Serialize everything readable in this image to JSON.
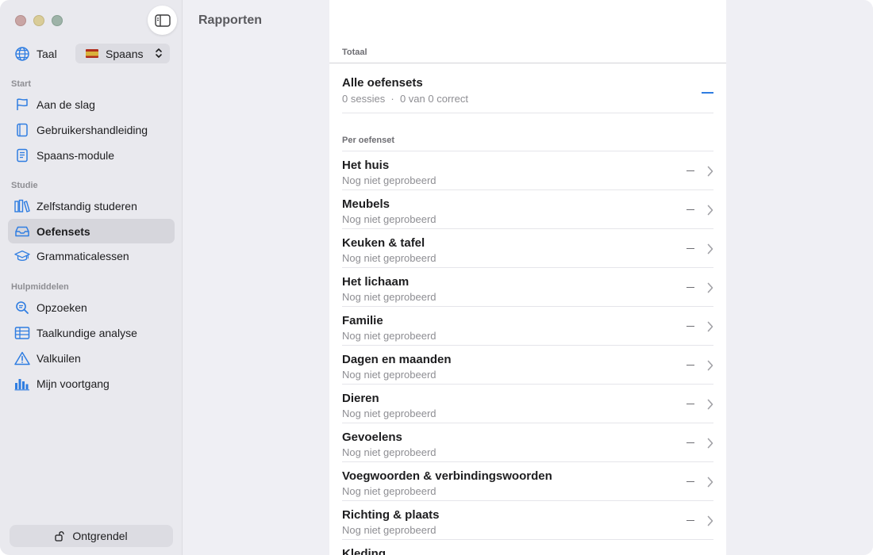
{
  "sidebar": {
    "language_label": "Taal",
    "language_value": "Spaans",
    "sections": [
      {
        "title": "Start",
        "items": [
          {
            "label": "Aan de slag",
            "icon": "flag-icon"
          },
          {
            "label": "Gebruikershandleiding",
            "icon": "book-icon"
          },
          {
            "label": "Spaans-module",
            "icon": "module-book-icon"
          }
        ]
      },
      {
        "title": "Studie",
        "items": [
          {
            "label": "Zelfstandig studeren",
            "icon": "books-icon"
          },
          {
            "label": "Oefensets",
            "icon": "tray-icon",
            "active": true
          },
          {
            "label": "Grammaticalessen",
            "icon": "graduation-cap-icon"
          }
        ]
      },
      {
        "title": "Hulpmiddelen",
        "items": [
          {
            "label": "Opzoeken",
            "icon": "magnifier-icon"
          },
          {
            "label": "Taalkundige analyse",
            "icon": "table-icon"
          },
          {
            "label": "Valkuilen",
            "icon": "warning-icon"
          },
          {
            "label": "Mijn voortgang",
            "icon": "bar-chart-icon"
          }
        ]
      }
    ],
    "unlock_label": "Ontgrendel"
  },
  "header": {
    "title": "Rapporten"
  },
  "report": {
    "total_header": "Totaal",
    "summary_title": "Alle oefensets",
    "summary_sub": "0 sessies  ·  0 van 0 correct",
    "per_set_header": "Per oefenset",
    "rows": [
      {
        "title": "Het huis",
        "status": "Nog niet geprobeerd"
      },
      {
        "title": "Meubels",
        "status": "Nog niet geprobeerd"
      },
      {
        "title": "Keuken & tafel",
        "status": "Nog niet geprobeerd"
      },
      {
        "title": "Het lichaam",
        "status": "Nog niet geprobeerd"
      },
      {
        "title": "Familie",
        "status": "Nog niet geprobeerd"
      },
      {
        "title": "Dagen en maanden",
        "status": "Nog niet geprobeerd"
      },
      {
        "title": "Dieren",
        "status": "Nog niet geprobeerd"
      },
      {
        "title": "Gevoelens",
        "status": "Nog niet geprobeerd"
      },
      {
        "title": "Voegwoorden & verbindingswoorden",
        "status": "Nog niet geprobeerd"
      },
      {
        "title": "Richting & plaats",
        "status": "Nog niet geprobeerd"
      },
      {
        "title": "Kleding",
        "status": ""
      }
    ]
  },
  "colors": {
    "accent": "#2f7de1",
    "sidebar_bg": "#e9e9ee",
    "selection_bg": "#d6d6dc"
  }
}
